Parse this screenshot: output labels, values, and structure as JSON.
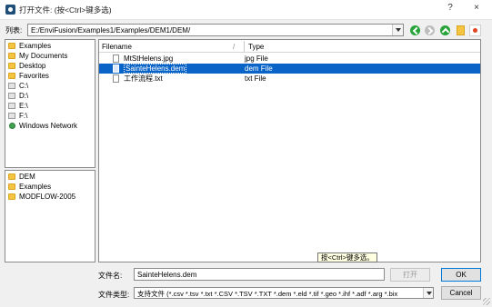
{
  "window": {
    "title": "打开文件: (按<Ctrl>键多选)",
    "help": "?",
    "close": "×"
  },
  "path_bar": {
    "label": "列表:",
    "value": "E:/EnviFusion/Examples1/Examples/DEM1/DEM/"
  },
  "toolbar": {
    "back_icon": "back-arrow-icon",
    "forward_icon": "forward-arrow-icon",
    "up_icon": "up-arrow-icon",
    "new_folder_icon": "new-folder-icon",
    "view_icon": "view-mode-icon"
  },
  "places": [
    {
      "label": "Examples",
      "icon": "folder-icon"
    },
    {
      "label": "My Documents",
      "icon": "folder-icon"
    },
    {
      "label": "Desktop",
      "icon": "folder-icon"
    },
    {
      "label": "Favorites",
      "icon": "folder-icon"
    },
    {
      "label": "C:\\",
      "icon": "drive-icon"
    },
    {
      "label": "D:\\",
      "icon": "drive-icon"
    },
    {
      "label": "E:\\",
      "icon": "drive-icon"
    },
    {
      "label": "F:\\",
      "icon": "drive-icon"
    },
    {
      "label": "Windows Network",
      "icon": "network-icon"
    }
  ],
  "recent": [
    {
      "label": "DEM",
      "icon": "folder-icon"
    },
    {
      "label": "Examples",
      "icon": "folder-icon"
    },
    {
      "label": "MODFLOW-2005",
      "icon": "folder-icon"
    }
  ],
  "file_list": {
    "headers": {
      "name": "Filename",
      "type": "Type",
      "sort_indicator": "/"
    },
    "rows": [
      {
        "name": "MtStHelens.jpg",
        "type": "jpg File",
        "selected": false
      },
      {
        "name": "SainteHelens.dem",
        "type": "dem File",
        "selected": true
      },
      {
        "name": "工作流程.txt",
        "type": "txt File",
        "selected": false
      }
    ]
  },
  "tooltip": "按<Ctrl>键多选。",
  "filename": {
    "label": "文件名:",
    "value": "SainteHelens.dem"
  },
  "filetype": {
    "label": "文件类型:",
    "value": "支持文件 (*.csv *.tsv *.txt *.CSV *.TSV *.TXT *.dem *.eld *.tif *.geo *.ihf *.adf *.arg *.bix"
  },
  "buttons": {
    "open": "打开",
    "ok": "OK",
    "cancel": "Cancel"
  }
}
